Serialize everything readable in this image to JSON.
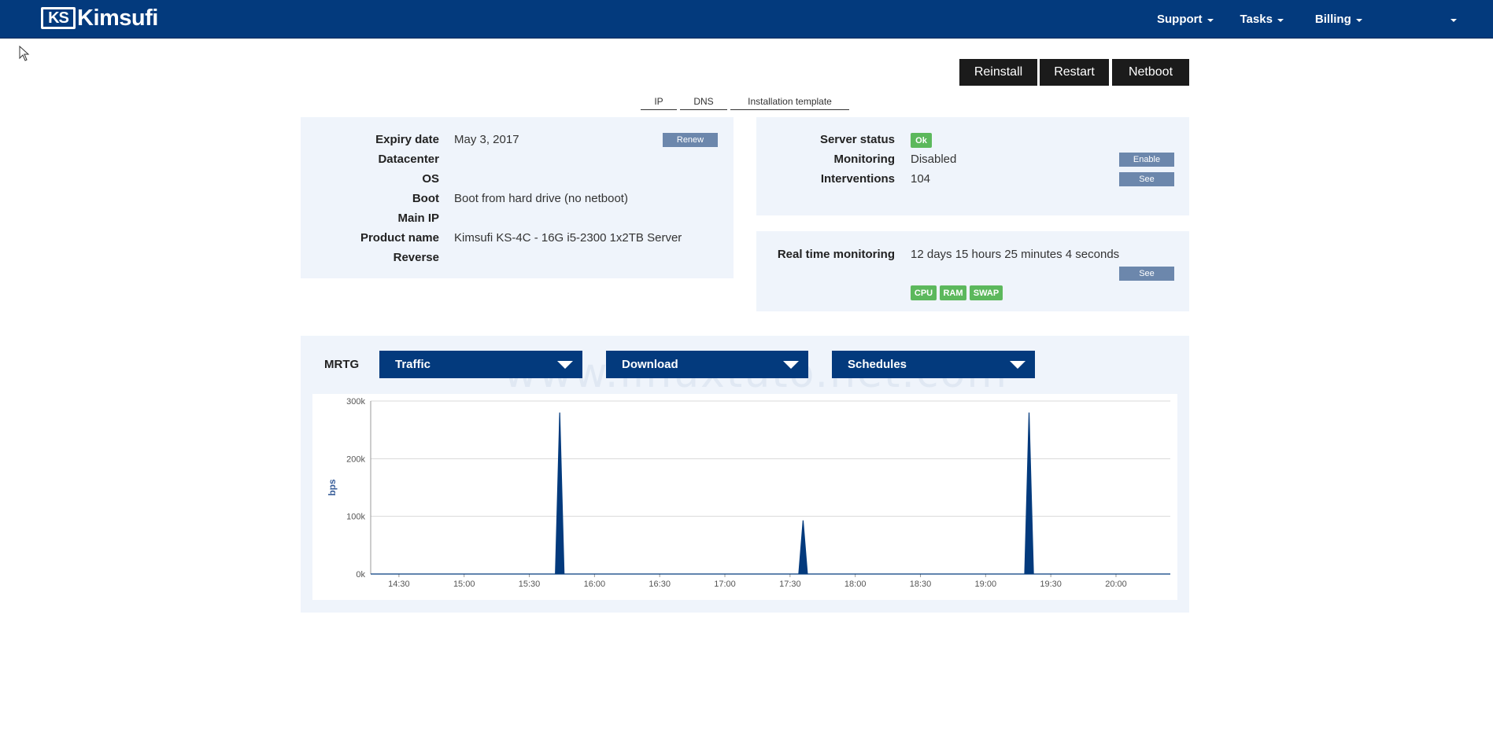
{
  "nav": {
    "logo_mark": "KS",
    "logo_text": "Kimsufi",
    "items": [
      {
        "label": "Support"
      },
      {
        "label": "Tasks"
      },
      {
        "label": "Billing"
      }
    ]
  },
  "actions": {
    "reinstall": "Reinstall",
    "restart": "Restart",
    "netboot": "Netboot"
  },
  "tabs": [
    "IP",
    "DNS",
    "Installation template"
  ],
  "server_info": {
    "expiry_label": "Expiry date",
    "expiry_value": "May 3, 2017",
    "renew_button": "Renew",
    "datacenter_label": "Datacenter",
    "os_label": "OS",
    "boot_label": "Boot",
    "boot_value": "Boot from hard drive (no netboot)",
    "main_ip_label": "Main IP",
    "product_label": "Product name",
    "product_value": "Kimsufi KS-4C - 16G i5-2300 1x2TB Server",
    "reverse_label": "Reverse"
  },
  "status": {
    "server_status_label": "Server status",
    "server_status_badge": "Ok",
    "monitoring_label": "Monitoring",
    "monitoring_value": "Disabled",
    "enable_button": "Enable",
    "interventions_label": "Interventions",
    "interventions_value": "104",
    "see_button": "See"
  },
  "realtime": {
    "label": "Real time monitoring",
    "value": "12 days 15 hours 25 minutes 4 seconds",
    "see_button": "See",
    "badges": [
      "CPU",
      "RAM",
      "SWAP"
    ]
  },
  "mrtg": {
    "label": "MRTG",
    "selects": [
      "Traffic",
      "Download",
      "Schedules"
    ],
    "watermark": "www.linuxtuto.net.com"
  },
  "chart_data": {
    "type": "area",
    "title": "",
    "xlabel": "",
    "ylabel": "bps",
    "ylim": [
      0,
      300000
    ],
    "y_ticks": [
      "0k",
      "100k",
      "200k",
      "300k"
    ],
    "x_ticks": [
      "14:30",
      "15:00",
      "15:30",
      "16:00",
      "16:30",
      "17:00",
      "17:30",
      "18:00",
      "18:30",
      "19:00",
      "19:30",
      "20:00"
    ],
    "x_range": [
      "14:17",
      "20:25"
    ],
    "color": "#033a7d",
    "grid": true,
    "series": [
      {
        "points": [
          {
            "t": "14:17",
            "v": 0
          },
          {
            "t": "15:42",
            "v": 0
          },
          {
            "t": "15:44",
            "v": 280000
          },
          {
            "t": "15:46",
            "v": 0
          },
          {
            "t": "17:34",
            "v": 0
          },
          {
            "t": "17:36",
            "v": 93000
          },
          {
            "t": "17:38",
            "v": 0
          },
          {
            "t": "19:18",
            "v": 0
          },
          {
            "t": "19:20",
            "v": 280000
          },
          {
            "t": "19:22",
            "v": 0
          },
          {
            "t": "20:25",
            "v": 0
          }
        ]
      }
    ]
  }
}
